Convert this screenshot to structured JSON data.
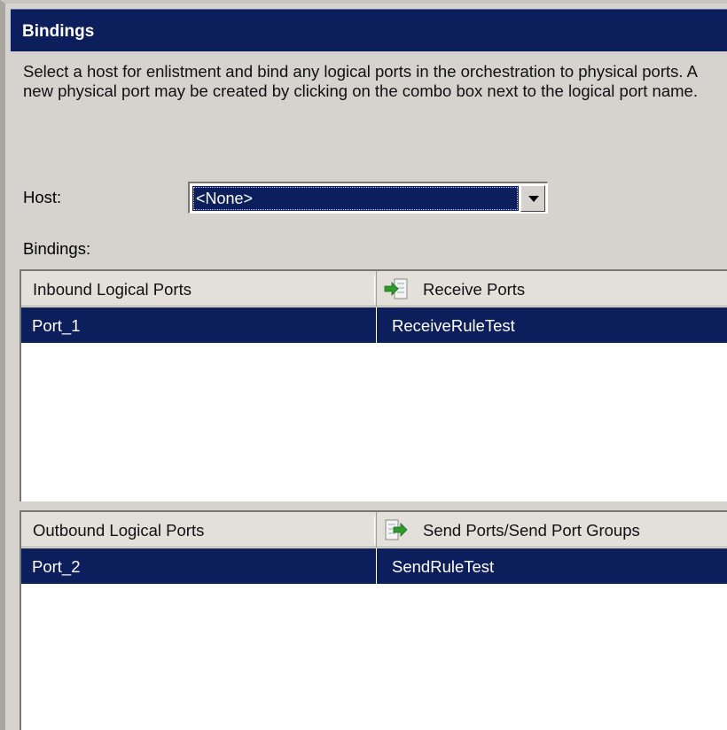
{
  "header": {
    "title": "Bindings"
  },
  "description": "Select a host for enlistment and bind any logical ports in the orchestration to physical ports. A new physical port may be created by clicking on the combo box next to the logical port name.",
  "host": {
    "label": "Host:",
    "value": "<None>"
  },
  "bindings_label": "Bindings:",
  "inbound": {
    "columns": [
      "Inbound Logical Ports",
      "Receive Ports"
    ],
    "header_icon": "receive-port-icon",
    "rows": [
      {
        "logical": "Port_1",
        "physical": "ReceiveRuleTest"
      }
    ]
  },
  "outbound": {
    "columns": [
      "Outbound Logical Ports",
      "Send Ports/Send Port Groups"
    ],
    "header_icon": "send-port-icon",
    "rows": [
      {
        "logical": "Port_2",
        "physical": "SendRuleTest"
      }
    ]
  },
  "colors": {
    "selection": "#0c1f5c",
    "dialog_bg": "#d6d3ce",
    "icon_green": "#2e9b2e"
  }
}
